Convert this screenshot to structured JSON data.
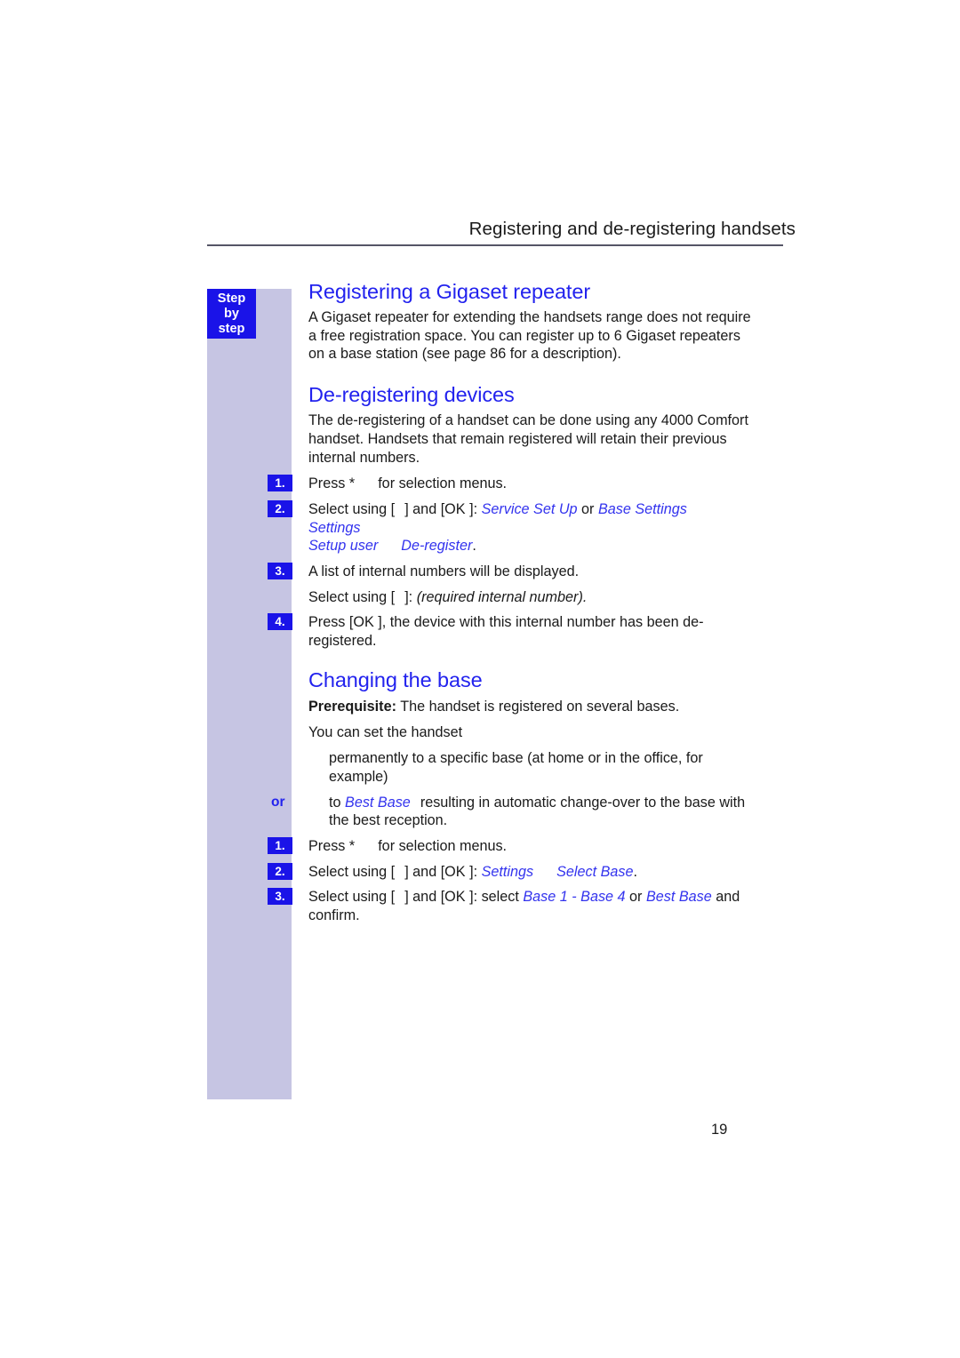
{
  "header": {
    "title": "Registering and de-registering handsets"
  },
  "sidebar": {
    "badge_line1": "Step",
    "badge_line2": "by",
    "badge_line3": "step",
    "or_label": "or",
    "step_numbers": {
      "one": "1.",
      "two": "2.",
      "three": "3.",
      "four": "4."
    }
  },
  "sections": {
    "repeater": {
      "title": "Registering a Gigaset repeater",
      "paragraph": "A Gigaset repeater for extending the handsets range does not require a free registration space. You can register up to 6 Gigaset repeaters on a base station (see page 86 for a description)."
    },
    "deregistering": {
      "title": "De-registering devices",
      "intro": "The de-registering of a handset can be done using any 4000 Comfort handset. Handsets that remain registered will retain their previous internal numbers.",
      "step1": "Press *",
      "step1_cont": "for selection menus.",
      "step2_lead": "Select using [",
      "step2_mid": "] and [OK ]:",
      "step2_path1": "Service Set Up",
      "step2_or": "or",
      "step2_path2": "Base Settings",
      "step2_path3": "Settings",
      "step2_path4": "Setup user",
      "step2_path5": "De-register",
      "step2_period": ".",
      "step3": "A list of internal numbers will be displayed.",
      "step3_sub_lead": "Select using [",
      "step3_sub_mid": "]:",
      "step3_sub_italic": "(required internal number).",
      "step4": "Press [OK ], the device with this internal number has been de-registered."
    },
    "changingbase": {
      "title": "Changing the base",
      "prereq_label": "Prerequisite:",
      "prereq_text": "The handset is registered on several bases.",
      "lead": "You can set the handset",
      "bullet1": "permanently to a specific base (at home or in the office, for example)",
      "bullet2_lead": "to",
      "bullet2_italic": "Best Base",
      "bullet2_tail": "resulting in automatic change-over to the base with the best reception.",
      "step1": "Press *",
      "step1_cont": "for selection menus.",
      "step2_lead": "Select using [",
      "step2_mid": "] and [OK ]:",
      "step2_path1": "Settings",
      "step2_path2": "Select Base",
      "step2_period": ".",
      "step3_lead": "Select using [",
      "step3_mid": "] and [OK ]: select",
      "step3_path1": "Base 1 - Base 4",
      "step3_or": "or",
      "step3_path2": "Best Base",
      "step3_tail": "and confirm."
    }
  },
  "footer": {
    "page_number": "19"
  },
  "colors": {
    "heading_blue": "#2222ee",
    "badge_blue": "#1a13e8",
    "sidebar_lavender": "#c6c5e3",
    "rule_gray": "#555566"
  }
}
